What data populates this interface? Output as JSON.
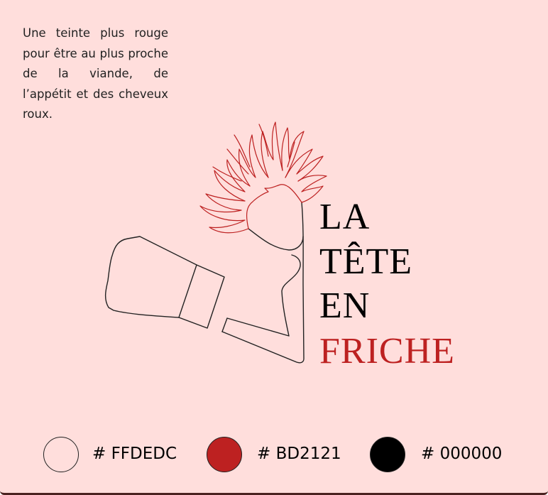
{
  "description": "Une teinte plus rouge pour être au plus proche  de la viande, de l’appétit et des cheveux roux.",
  "logo": {
    "line1": "LA",
    "line2": "TÊTE",
    "line3": "EN",
    "line4": "FRICHE"
  },
  "palette": [
    {
      "label": "# FFDEDC",
      "color": "#FFDEDC"
    },
    {
      "label": "# BD2121",
      "color": "#BD2121"
    },
    {
      "label": "# 000000",
      "color": "#000000"
    }
  ]
}
